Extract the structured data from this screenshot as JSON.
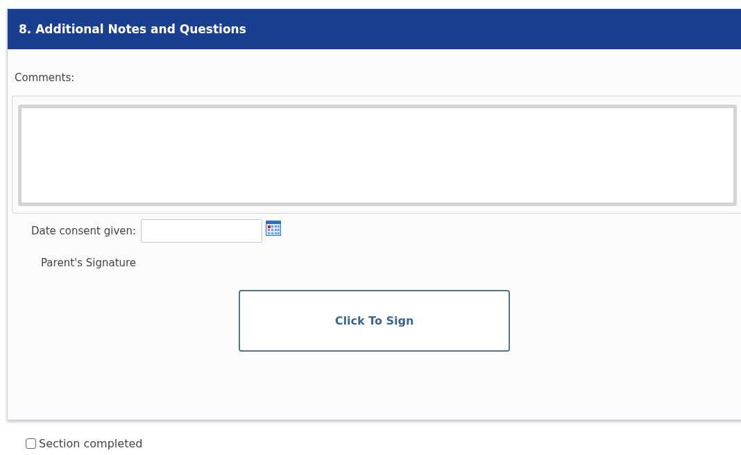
{
  "section": {
    "title": "8. Additional Notes and Questions"
  },
  "comments": {
    "label": "Comments:"
  },
  "date_consent": {
    "label": "Date consent given:"
  },
  "signature": {
    "label": "Parent's Signature",
    "button": "Click To Sign"
  },
  "section_completed": {
    "label": "Section completed",
    "checked": false
  }
}
